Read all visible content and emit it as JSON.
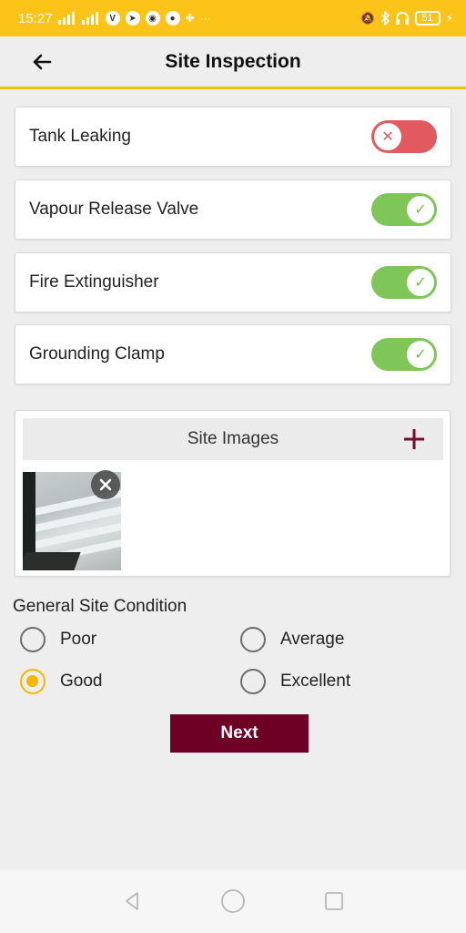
{
  "status_bar": {
    "time": "15:27",
    "battery": "51",
    "left_icons": [
      "signal-icon",
      "signal-icon",
      "viber-icon",
      "telegram-icon",
      "discord-icon",
      "chrome-icon",
      "slack-icon",
      "more-icon"
    ],
    "right_icons": [
      "mute-icon",
      "bluetooth-icon",
      "headphones-icon",
      "battery-icon",
      "charging-icon"
    ]
  },
  "header": {
    "title": "Site Inspection",
    "back_icon": "arrow-left-icon"
  },
  "toggles": [
    {
      "label": "Tank Leaking",
      "state": "off"
    },
    {
      "label": "Vapour Release Valve",
      "state": "on"
    },
    {
      "label": "Fire Extinguisher",
      "state": "on"
    },
    {
      "label": "Grounding Clamp",
      "state": "on"
    }
  ],
  "images": {
    "title": "Site Images",
    "add_icon": "plus-icon",
    "remove_icon": "close-icon"
  },
  "condition": {
    "label": "General Site Condition",
    "options": [
      "Poor",
      "Average",
      "Good",
      "Excellent"
    ],
    "selected": "Good"
  },
  "next_label": "Next",
  "colors": {
    "status_bar": "#fcc419",
    "accent": "#f5b800",
    "toggle_on": "#7dc657",
    "toggle_off": "#e05a5f",
    "primary_button": "#6e0026"
  }
}
